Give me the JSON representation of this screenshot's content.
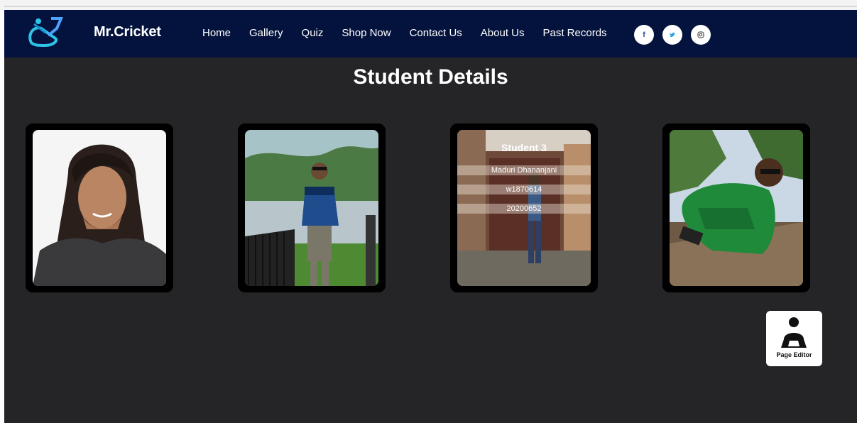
{
  "navbar": {
    "brand": "Mr.Cricket",
    "links": [
      "Home",
      "Gallery",
      "Quiz",
      "Shop Now",
      "Contact Us",
      "About Us",
      "Past Records"
    ],
    "social": [
      {
        "icon": "facebook-icon",
        "glyph": "f"
      },
      {
        "icon": "twitter-icon",
        "glyph": "🐦"
      },
      {
        "icon": "instagram-icon",
        "glyph": "◎"
      }
    ]
  },
  "main": {
    "title": "Student Details",
    "cards": [
      {
        "photo": "student-photo-1"
      },
      {
        "photo": "student-photo-2"
      },
      {
        "photo": "student-photo-3",
        "title": "Student 3",
        "name": "Maduri Dhananjani",
        "id": "w1870614",
        "number": "20200652"
      },
      {
        "photo": "student-photo-4"
      }
    ]
  },
  "page_editor": {
    "label": "Page Editor"
  },
  "colors": {
    "navbar": "#04133d",
    "background": "#252527",
    "accent": "#2ec4e8"
  }
}
